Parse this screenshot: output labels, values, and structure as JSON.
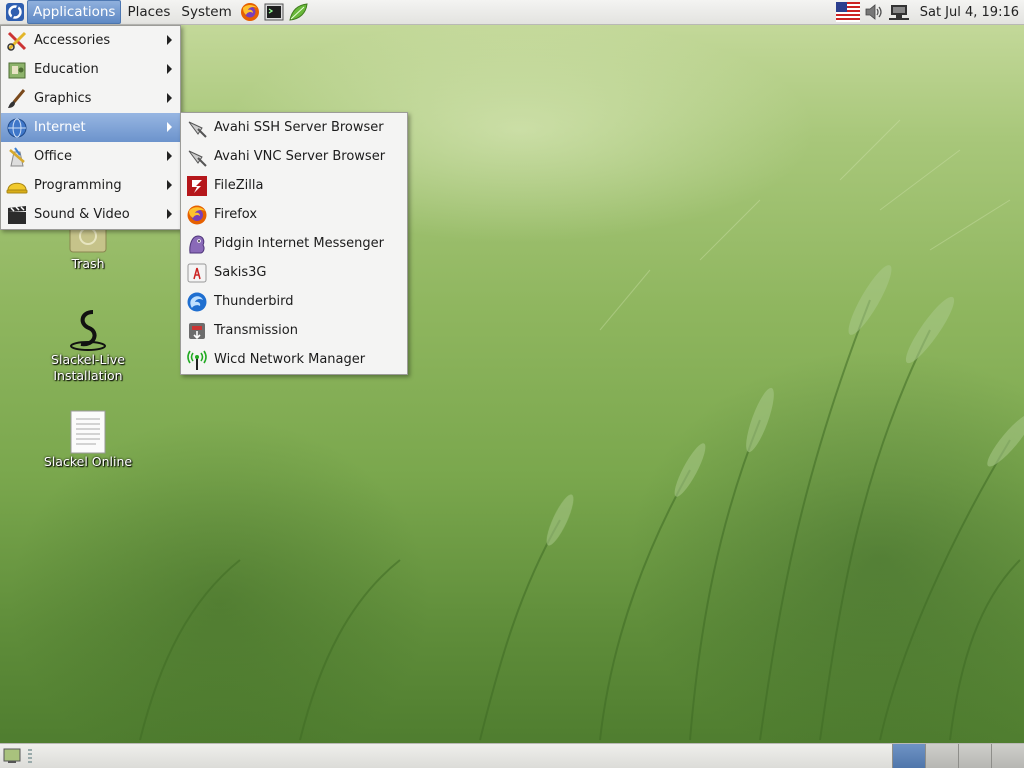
{
  "top_panel": {
    "menus": [
      "Applications",
      "Places",
      "System"
    ],
    "launchers": [
      "firefox-icon",
      "terminal-icon",
      "leaf-icon"
    ],
    "tray": [
      "us-flag-icon",
      "volume-icon",
      "network-icon"
    ],
    "clock": "Sat Jul  4, 19:16"
  },
  "applications_menu": {
    "items": [
      {
        "label": "Accessories",
        "icon": "accessories-icon"
      },
      {
        "label": "Education",
        "icon": "education-icon"
      },
      {
        "label": "Graphics",
        "icon": "graphics-icon"
      },
      {
        "label": "Internet",
        "icon": "internet-icon"
      },
      {
        "label": "Office",
        "icon": "office-icon"
      },
      {
        "label": "Programming",
        "icon": "programming-icon"
      },
      {
        "label": "Sound & Video",
        "icon": "sound-video-icon"
      }
    ],
    "selected": "Internet"
  },
  "internet_submenu": {
    "items": [
      {
        "label": "Avahi SSH Server Browser",
        "icon": "avahi-ssh-icon"
      },
      {
        "label": "Avahi VNC Server Browser",
        "icon": "avahi-vnc-icon"
      },
      {
        "label": "FileZilla",
        "icon": "filezilla-icon"
      },
      {
        "label": "Firefox",
        "icon": "firefox-icon"
      },
      {
        "label": "Pidgin Internet Messenger",
        "icon": "pidgin-icon"
      },
      {
        "label": "Sakis3G",
        "icon": "sakis3g-icon"
      },
      {
        "label": "Thunderbird",
        "icon": "thunderbird-icon"
      },
      {
        "label": "Transmission",
        "icon": "transmission-icon"
      },
      {
        "label": "Wicd Network Manager",
        "icon": "wicd-icon"
      }
    ]
  },
  "desktop_icons": [
    {
      "label": "Trash",
      "icon": "trash-icon"
    },
    {
      "label": "Slackel-Live Installation",
      "icon": "slackel-icon"
    },
    {
      "label": "Slackel Online",
      "icon": "document-icon"
    }
  ],
  "bottom_panel": {
    "workspaces": 4,
    "current_workspace": 1
  },
  "colors": {
    "selection": "#6c93cc",
    "wallpaper": "#7aa74d"
  }
}
